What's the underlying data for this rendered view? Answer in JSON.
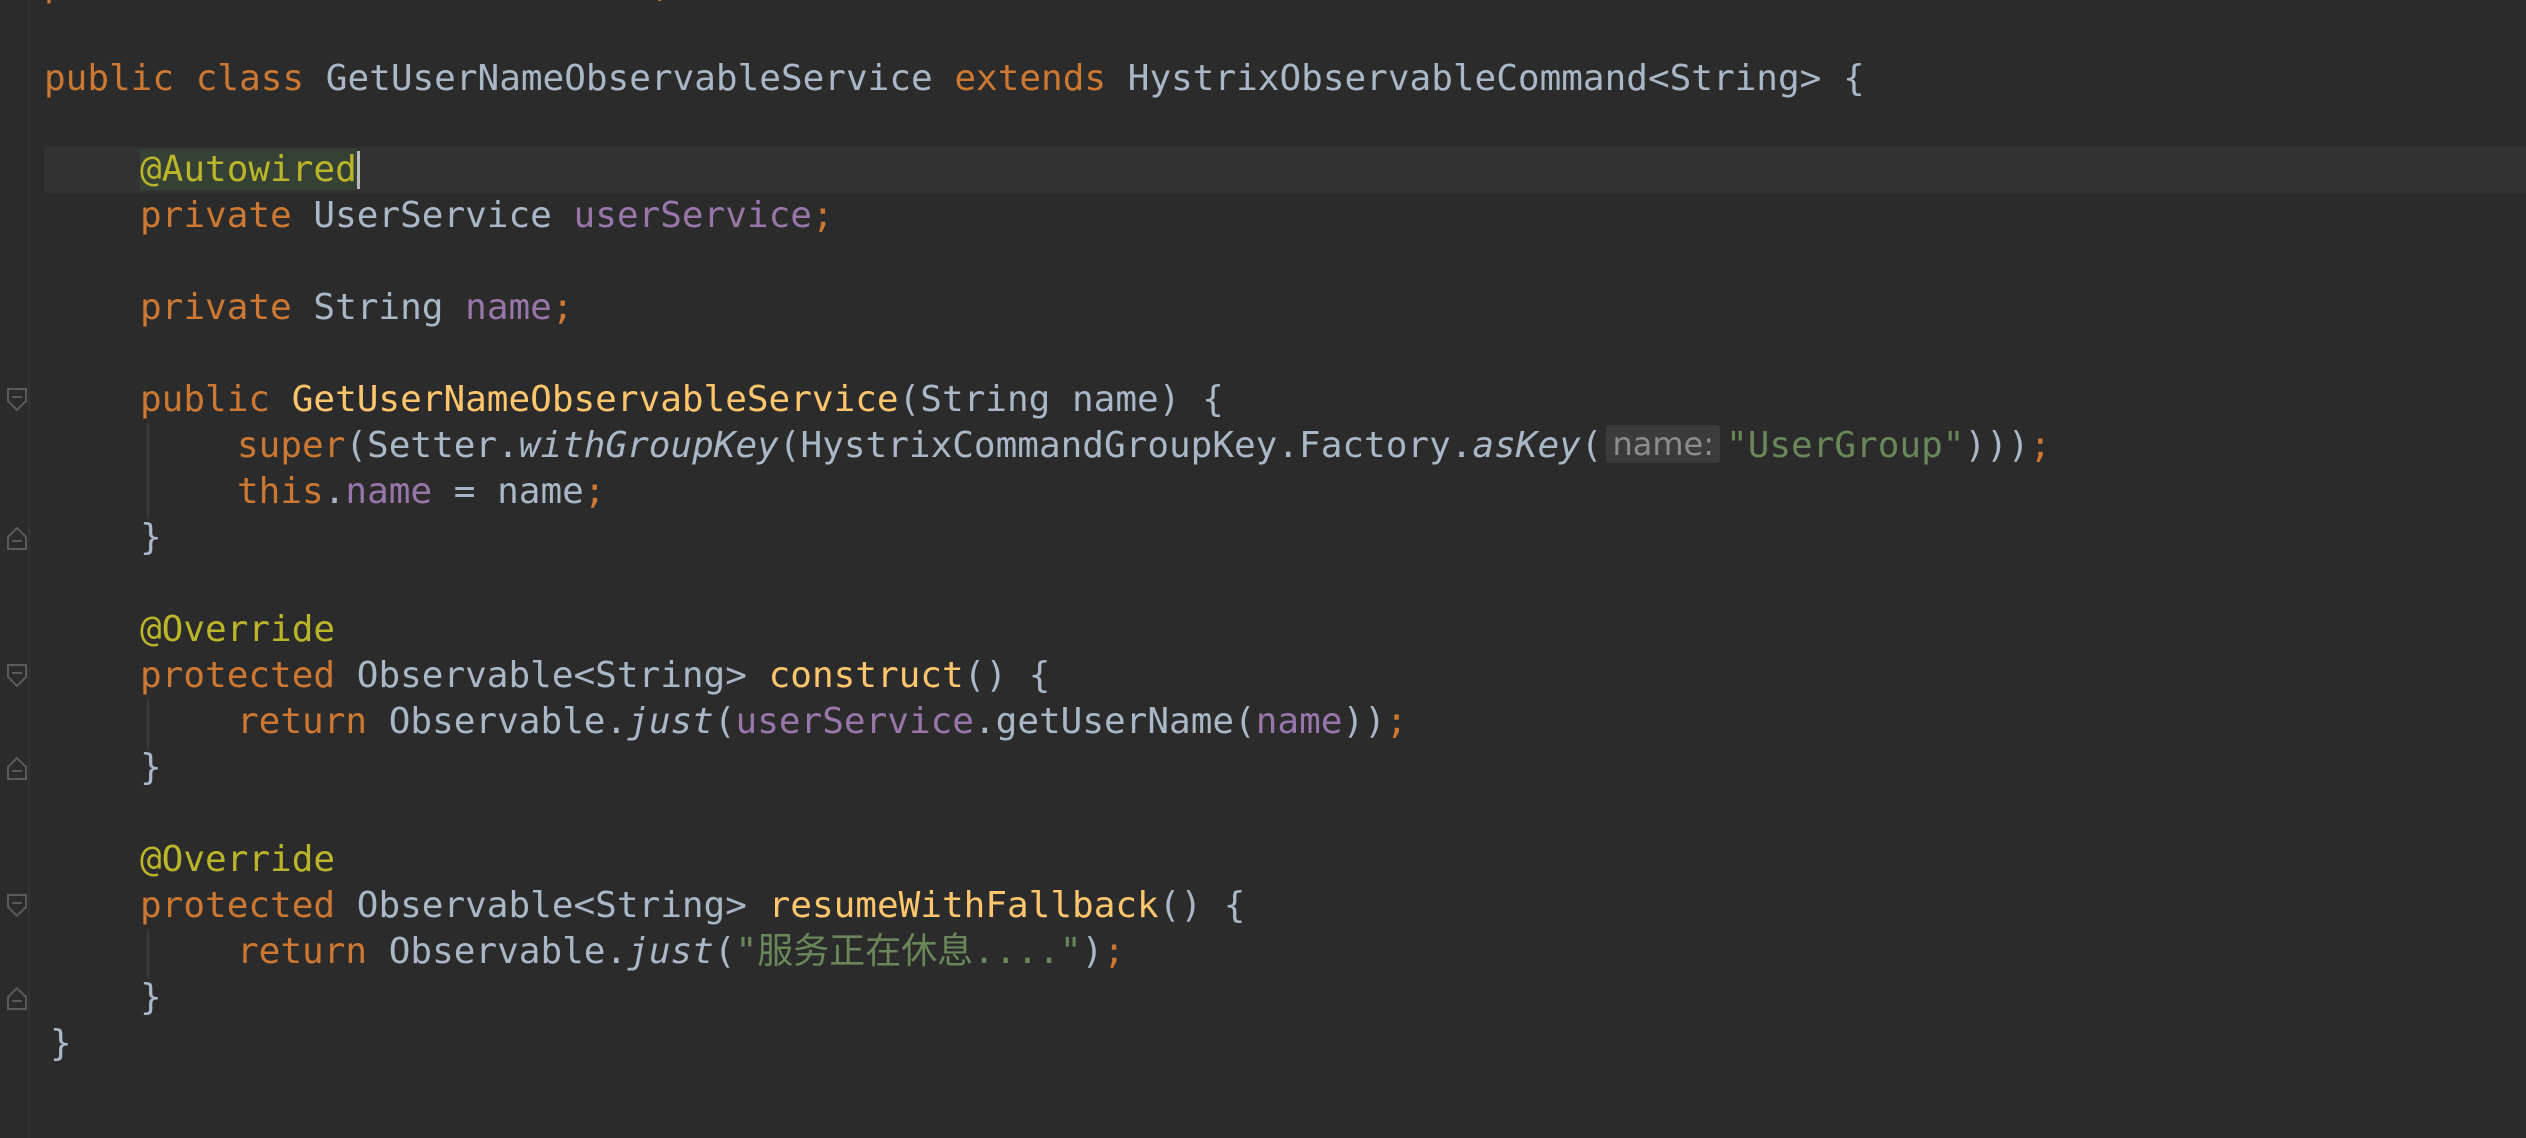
{
  "code": {
    "top_partial": "p                           ,",
    "class_decl": {
      "kw_public": "public",
      "kw_class": "class",
      "class_name": "GetUserNameObservableService",
      "kw_extends": "extends",
      "super_type": "HystrixObservableCommand<String>",
      "open_brace": "{"
    },
    "autowired": "@Autowired",
    "field1": {
      "kw": "private",
      "type": "UserService",
      "name": "userService",
      "semi": ";"
    },
    "field2": {
      "kw": "private",
      "type": "String",
      "name": "name",
      "semi": ";"
    },
    "ctor": {
      "kw": "public",
      "name": "GetUserNameObservableService",
      "params": "(String name)",
      "open": "{",
      "super_kw": "super",
      "super_p1": "(Setter.",
      "with_group_key": "withGroupKey",
      "super_p2": "(HystrixCommandGroupKey.Factory.",
      "as_key": "asKey",
      "super_p3": "(",
      "hint": "name:",
      "group_str": "\"UserGroup\"",
      "super_close": ")))",
      "semi": ";",
      "this_kw": "this",
      "dot": ".",
      "this_field": "name",
      "assign": " = name",
      "close": "}"
    },
    "override1": "@Override",
    "construct": {
      "kw": "protected",
      "ret_type": "Observable<String>",
      "name": "construct",
      "parens": "()",
      "open": "{",
      "return_kw": "return",
      "obs": "Observable.",
      "just": "just",
      "p_open": "(",
      "svc": "userService",
      "call": ".getUserName(",
      "arg": "name",
      "p_close": "))",
      "semi": ";",
      "close": "}"
    },
    "override2": "@Override",
    "fallback": {
      "kw": "protected",
      "ret_type": "Observable<String>",
      "name": "resumeWithFallback",
      "parens": "()",
      "open": "{",
      "return_kw": "return",
      "obs": "Observable.",
      "just": "just",
      "p_open": "(",
      "msg": "\"服务正在休息....\"",
      "p_close": ")",
      "semi": ";",
      "close": "}"
    },
    "class_close": "}"
  }
}
